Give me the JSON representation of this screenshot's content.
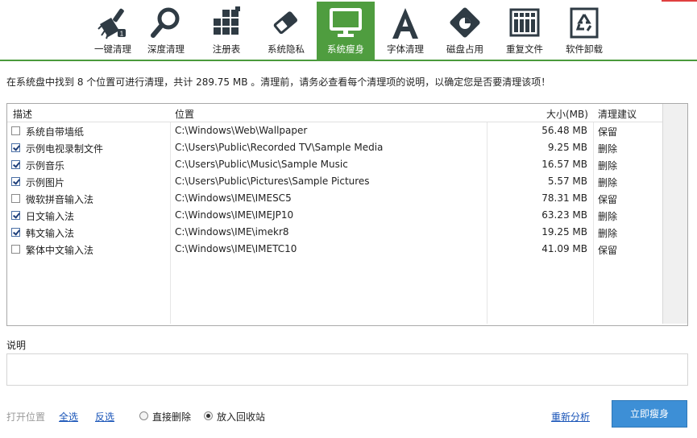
{
  "toolbar": {
    "items": [
      {
        "label": "一键清理",
        "icon": "broom-icon",
        "active": false
      },
      {
        "label": "深度清理",
        "icon": "magnifier-icon",
        "active": false
      },
      {
        "label": "注册表",
        "icon": "registry-blocks-icon",
        "active": false
      },
      {
        "label": "系统隐私",
        "icon": "eraser-icon",
        "active": false
      },
      {
        "label": "系统瘦身",
        "icon": "monitor-icon",
        "active": true
      },
      {
        "label": "字体清理",
        "icon": "font-letter-icon",
        "active": false
      },
      {
        "label": "磁盘占用",
        "icon": "disk-chart-icon",
        "active": false
      },
      {
        "label": "重复文件",
        "icon": "duplicate-grid-icon",
        "active": false
      },
      {
        "label": "软件卸载",
        "icon": "recycle-icon",
        "active": false
      }
    ],
    "accent_color": "#4f9d3f"
  },
  "summary": "在系统盘中找到 8 个位置可进行清理，共计 289.75 MB 。清理前，请务必查看每个清理项的说明，以确定您是否要清理该项！",
  "table": {
    "headers": {
      "desc": "描述",
      "path": "位置",
      "size": "大小(MB)",
      "advice": "清理建议"
    },
    "rows": [
      {
        "checked": false,
        "name": "系统自带墙纸",
        "path": "C:\\Windows\\Web\\Wallpaper",
        "size": "56.48 MB",
        "advice": "保留"
      },
      {
        "checked": true,
        "name": "示例电视录制文件",
        "path": "C:\\Users\\Public\\Recorded TV\\Sample Media",
        "size": "9.25 MB",
        "advice": "删除"
      },
      {
        "checked": true,
        "name": "示例音乐",
        "path": "C:\\Users\\Public\\Music\\Sample Music",
        "size": "16.57 MB",
        "advice": "删除"
      },
      {
        "checked": true,
        "name": "示例图片",
        "path": "C:\\Users\\Public\\Pictures\\Sample Pictures",
        "size": "5.57 MB",
        "advice": "删除"
      },
      {
        "checked": false,
        "name": "微软拼音输入法",
        "path": "C:\\Windows\\IME\\IMESC5",
        "size": "78.31 MB",
        "advice": "保留"
      },
      {
        "checked": true,
        "name": "日文输入法",
        "path": "C:\\Windows\\IME\\IMEJP10",
        "size": "63.23 MB",
        "advice": "删除"
      },
      {
        "checked": true,
        "name": "韩文输入法",
        "path": "C:\\Windows\\IME\\imekr8",
        "size": "19.25 MB",
        "advice": "删除"
      },
      {
        "checked": false,
        "name": "繁体中文输入法",
        "path": "C:\\Windows\\IME\\IMETC10",
        "size": "41.09 MB",
        "advice": "保留"
      }
    ]
  },
  "description": {
    "label": "说明",
    "text": ""
  },
  "footer": {
    "open_location": "打开位置",
    "select_all": "全选",
    "invert_selection": "反选",
    "radio_direct_delete": "直接删除",
    "radio_recycle_bin": "放入回收站",
    "selected_mode": "recycle",
    "reanalyze": "重新分析",
    "primary_button": "立即瘦身"
  }
}
